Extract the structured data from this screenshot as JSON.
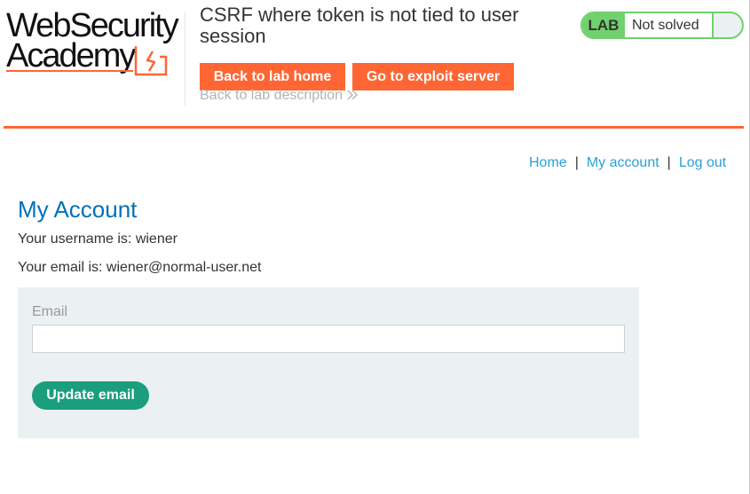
{
  "logo": {
    "line1": "WebSecurity",
    "line2": "Academy"
  },
  "header": {
    "lab_title": "CSRF where token is not tied to user session",
    "back_to_lab_home": "Back to lab home",
    "go_to_exploit_server": "Go to exploit server",
    "back_to_lab_description": "Back to lab description",
    "lab_badge": "LAB",
    "lab_status": "Not solved"
  },
  "nav": {
    "home": "Home",
    "my_account": "My account",
    "log_out": "Log out",
    "separator": "|"
  },
  "account": {
    "title": "My Account",
    "username_line": "Your username is: wiener",
    "email_line": "Your email is: wiener@normal-user.net"
  },
  "form": {
    "email_label": "Email",
    "email_value": "",
    "submit_label": "Update email"
  },
  "colors": {
    "brand_orange": "#ff6633",
    "lab_green": "#70d16d",
    "button_green": "#1a9e7d",
    "link_blue": "#29a0d8",
    "title_blue": "#0071bc",
    "form_bg": "#ebf0f2"
  },
  "icons": {
    "logo_mark": "academy-flash-icon",
    "description_chevron": "double-chevron-right-icon"
  }
}
